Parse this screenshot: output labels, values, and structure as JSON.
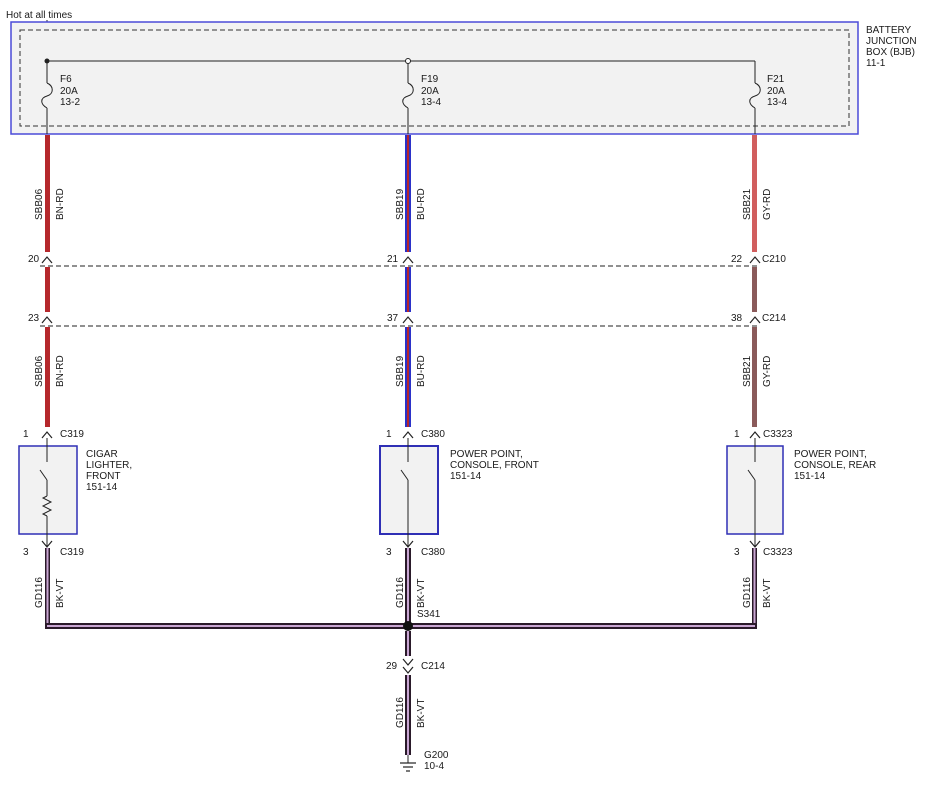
{
  "header": {
    "hot_label": "Hot at all times"
  },
  "bjb": {
    "title_lines": [
      "BATTERY",
      "JUNCTION",
      "BOX (BJB)",
      "11-1"
    ]
  },
  "fuses": [
    {
      "name": "F6",
      "rating": "20A",
      "ref": "13-2"
    },
    {
      "name": "F19",
      "rating": "20A",
      "ref": "13-4"
    },
    {
      "name": "F21",
      "rating": "20A",
      "ref": "13-4"
    }
  ],
  "upper_wires": [
    {
      "circuit": "SBB06",
      "color": "BN-RD"
    },
    {
      "circuit": "SBB19",
      "color": "BU-RD"
    },
    {
      "circuit": "SBB21",
      "color": "GY-RD"
    }
  ],
  "connector_c210": {
    "name": "C210",
    "pins": [
      "20",
      "21",
      "22"
    ]
  },
  "connector_c214": {
    "name": "C214",
    "pins": [
      "23",
      "37",
      "38"
    ]
  },
  "lower_wires": [
    {
      "circuit": "SBB06",
      "color": "BN-RD"
    },
    {
      "circuit": "SBB19",
      "color": "BU-RD"
    },
    {
      "circuit": "SBB21",
      "color": "GY-RD"
    }
  ],
  "devices": [
    {
      "top_pin": "1",
      "top_conn": "C319",
      "lines": [
        "CIGAR",
        "LIGHTER,",
        "FRONT",
        "151-14"
      ],
      "bottom_pin": "3",
      "bottom_conn": "C319"
    },
    {
      "top_pin": "1",
      "top_conn": "C380",
      "lines": [
        "POWER POINT,",
        "CONSOLE, FRONT",
        "151-14"
      ],
      "bottom_pin": "3",
      "bottom_conn": "C380"
    },
    {
      "top_pin": "1",
      "top_conn": "C3323",
      "lines": [
        "POWER POINT,",
        "CONSOLE, REAR",
        "151-14"
      ],
      "bottom_pin": "3",
      "bottom_conn": "C3323"
    }
  ],
  "ground_wires": [
    {
      "circuit": "GD116",
      "color": "BK-VT"
    },
    {
      "circuit": "GD116",
      "color": "BK-VT"
    },
    {
      "circuit": "GD116",
      "color": "BK-VT"
    }
  ],
  "splice": {
    "name": "S341"
  },
  "ground_connector": {
    "pin": "29",
    "name": "C214"
  },
  "ground_wire_main": {
    "circuit": "GD116",
    "color": "BK-VT"
  },
  "ground": {
    "name": "G200",
    "ref": "10-4"
  },
  "colors": {
    "bn_rd": "#b5282c",
    "bu_rd_outer": "#2b32c9",
    "bu_rd_stripe": "#b5282c",
    "gy_rd": "#d15e5e",
    "gy_rd_lower": "#8a5a5a",
    "bk_vt_outer": "#2a1a2a",
    "bk_vt_stripe": "#c9a6d3",
    "bjb_border": "#4b4bd8",
    "device_border": "#2f2fb5"
  }
}
